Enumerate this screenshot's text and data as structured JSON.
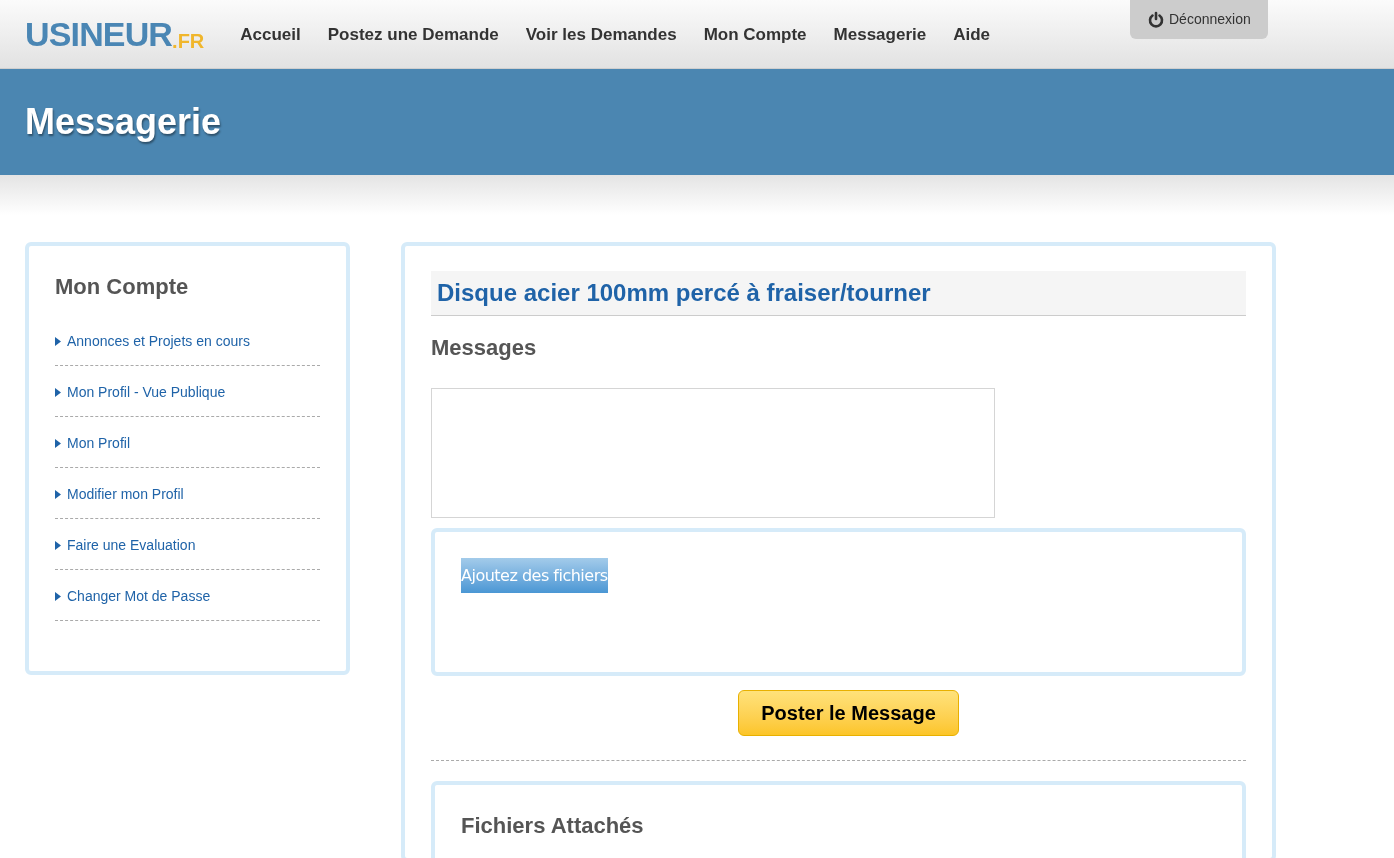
{
  "logo": {
    "name": "USINEUR",
    "suffix": ".FR"
  },
  "nav": [
    {
      "label": "Accueil"
    },
    {
      "label": "Postez une Demande"
    },
    {
      "label": "Voir les Demandes"
    },
    {
      "label": "Mon Compte"
    },
    {
      "label": "Messagerie"
    },
    {
      "label": "Aide"
    }
  ],
  "logout": {
    "label": "Déconnexion"
  },
  "banner": {
    "title": "Messagerie"
  },
  "sidebar": {
    "title": "Mon Compte",
    "items": [
      {
        "label": "Annonces et Projets en cours"
      },
      {
        "label": "Mon Profil - Vue Publique"
      },
      {
        "label": "Mon Profil"
      },
      {
        "label": "Modifier mon Profil"
      },
      {
        "label": "Faire une Evaluation"
      },
      {
        "label": "Changer Mot de Passe"
      }
    ]
  },
  "main": {
    "title": "Disque acier 100mm percé à fraiser/tourner",
    "messages_heading": "Messages",
    "upload_button": "Ajoutez des fichiers",
    "post_button": "Poster le Message",
    "attachments_heading": "Fichiers Attachés"
  }
}
